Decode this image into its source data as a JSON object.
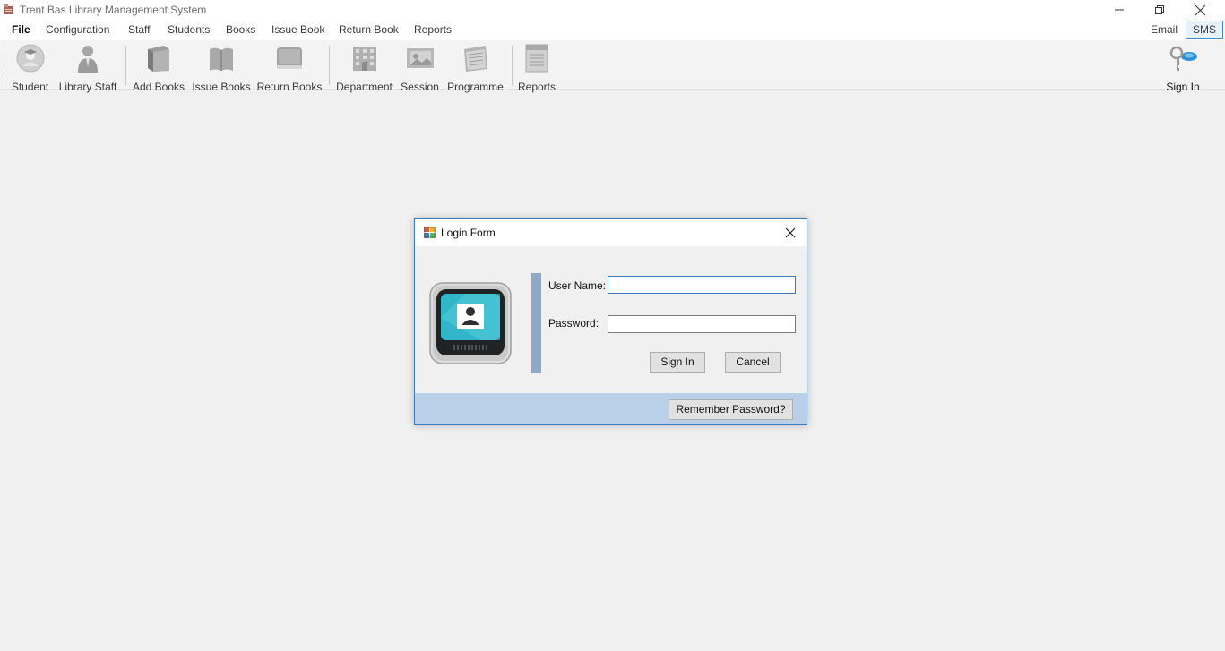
{
  "window": {
    "title": "Trent Bas Library Management System"
  },
  "menu": {
    "items": [
      {
        "label": "File"
      },
      {
        "label": "Configuration"
      },
      {
        "label": "Staff"
      },
      {
        "label": "Students"
      },
      {
        "label": "Books"
      },
      {
        "label": "Issue Book"
      },
      {
        "label": "Return Book"
      },
      {
        "label": "Reports"
      }
    ],
    "right_items": [
      {
        "label": "Email"
      },
      {
        "label": "SMS"
      }
    ]
  },
  "toolbar": {
    "items": [
      {
        "label": "Student",
        "icon": "student-icon"
      },
      {
        "label": "Library  Staff",
        "icon": "library-staff-icon"
      },
      {
        "label": "Add Books",
        "icon": "add-books-icon"
      },
      {
        "label": "Issue Books",
        "icon": "issue-books-icon"
      },
      {
        "label": "Return Books",
        "icon": "return-books-icon"
      },
      {
        "label": "Department",
        "icon": "department-icon"
      },
      {
        "label": "Session",
        "icon": "session-icon"
      },
      {
        "label": "Programme",
        "icon": "programme-icon"
      },
      {
        "label": "Reports",
        "icon": "reports-icon"
      }
    ],
    "sign_in_label": "Sign In",
    "sign_in_icon": "key-icon"
  },
  "dialog": {
    "title": "Login Form",
    "username_label": "User Name:",
    "username_value": "",
    "password_label": "Password:",
    "password_value": "",
    "sign_in_button": "Sign In",
    "cancel_button": "Cancel",
    "remember_button": "Remember Password?"
  },
  "colors": {
    "dialog_border": "#3e7bbf",
    "footer_bg": "#b9d0e8",
    "accent_bar": "#8ea9c8",
    "sms_highlight": "#3c88cc"
  }
}
